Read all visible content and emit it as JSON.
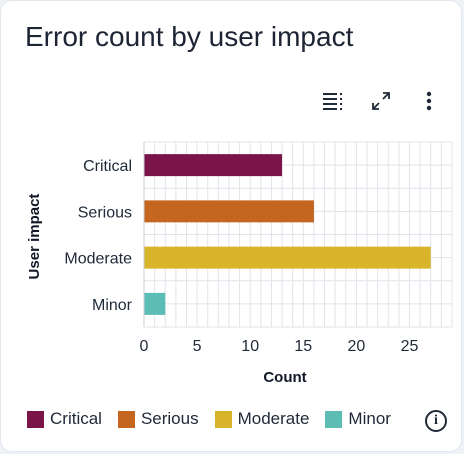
{
  "card": {
    "title": "Error count by user impact",
    "toolbar": {
      "legend_toggle_icon": "legend-list-icon",
      "expand_icon": "expand-diagonal-icon",
      "more_icon": "more-vertical-icon"
    },
    "info_icon": "info-circle-icon",
    "info_glyph": "i"
  },
  "chart_data": {
    "type": "bar",
    "orientation": "horizontal",
    "title": "Error count by user impact",
    "xlabel": "Count",
    "ylabel": "User impact",
    "categories": [
      "Critical",
      "Serious",
      "Moderate",
      "Minor"
    ],
    "values": [
      13,
      16,
      27,
      2
    ],
    "colors": [
      "#7b1448",
      "#c46620",
      "#d7b42a",
      "#5bbdb4"
    ],
    "xlim": [
      0,
      29
    ],
    "xticks": [
      0,
      5,
      10,
      15,
      20,
      25
    ],
    "grid": true,
    "legend": {
      "placement": "bottom",
      "entries": [
        "Critical",
        "Serious",
        "Moderate",
        "Minor"
      ]
    }
  }
}
